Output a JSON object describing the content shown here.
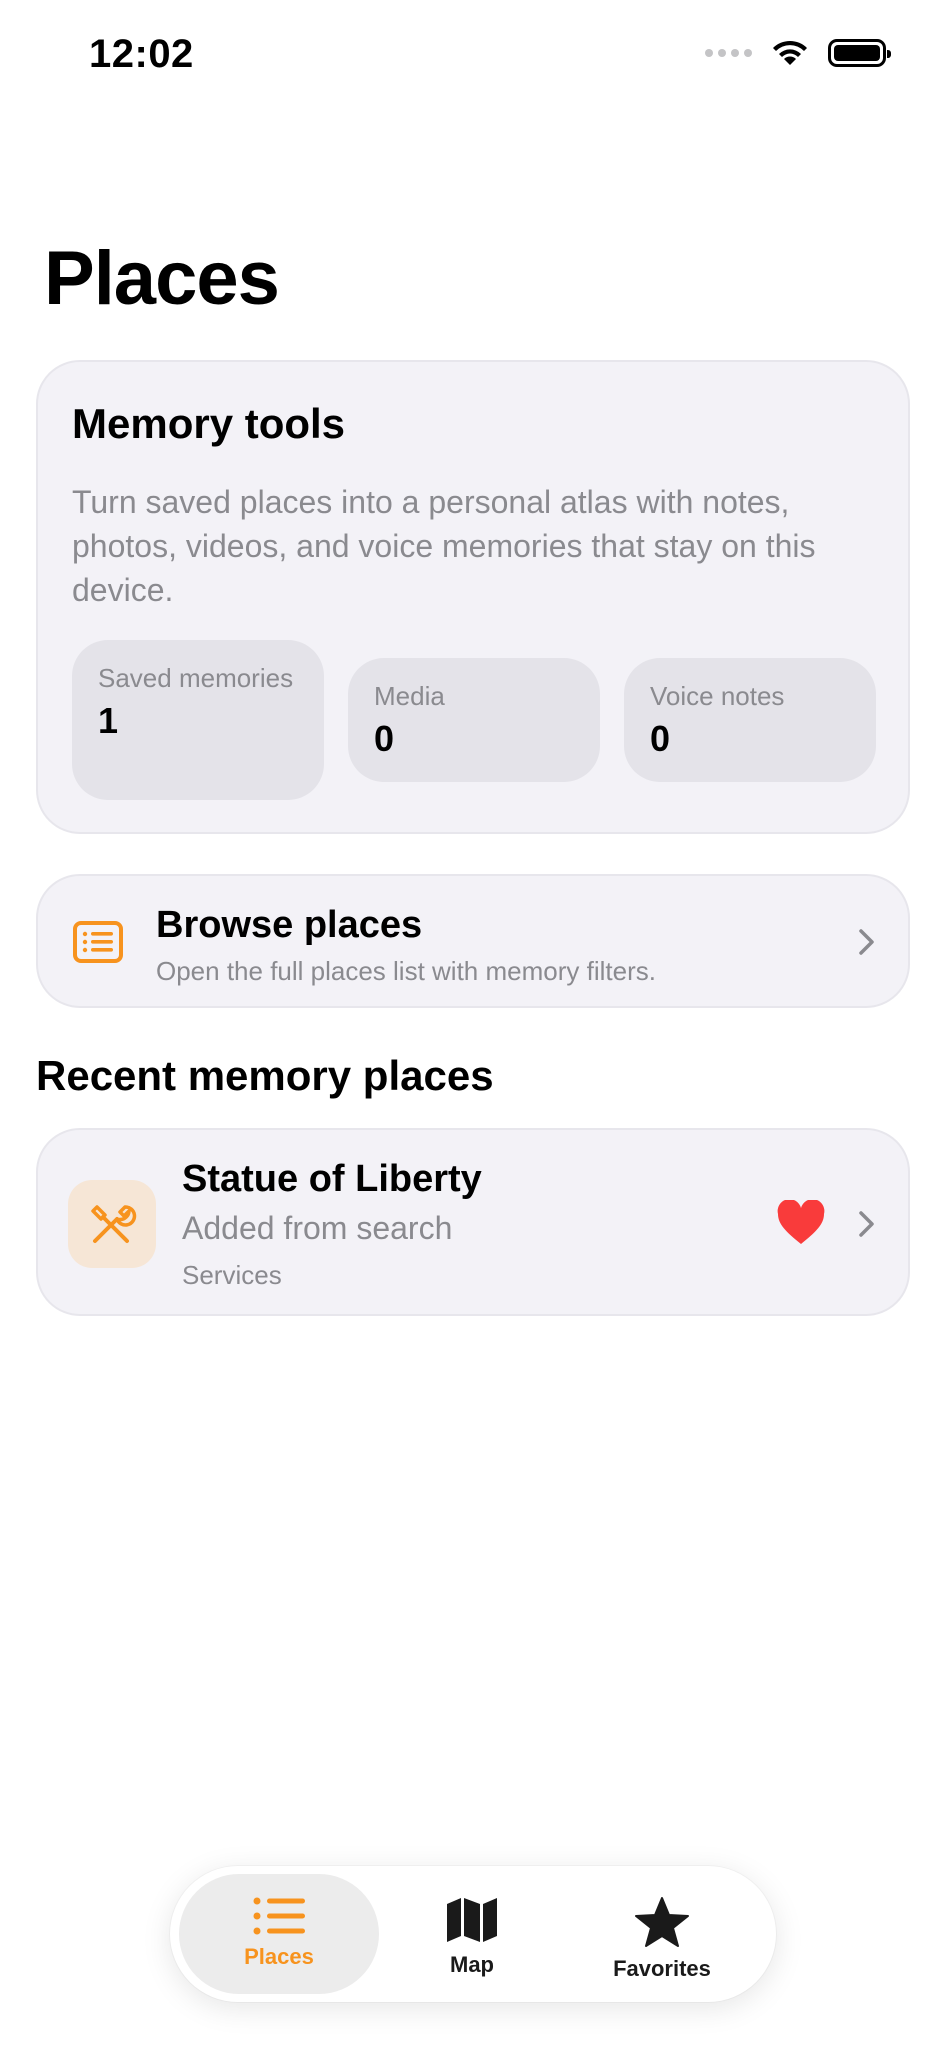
{
  "status_bar": {
    "time": "12:02"
  },
  "header": {
    "title": "Places"
  },
  "memory_tools": {
    "title": "Memory tools",
    "description": "Turn saved places into a personal atlas with notes, photos, videos, and voice memories that stay on this device.",
    "stats": [
      {
        "label": "Saved memories",
        "value": "1"
      },
      {
        "label": "Media",
        "value": "0"
      },
      {
        "label": "Voice notes",
        "value": "0"
      }
    ]
  },
  "browse": {
    "title": "Browse places",
    "subtitle": "Open the full places list with memory filters.",
    "icon": "list-box-icon"
  },
  "recent": {
    "title": "Recent memory places",
    "items": [
      {
        "name": "Statue of Liberty",
        "subtitle": "Added from search",
        "category": "Services",
        "icon": "tools-icon",
        "favorite": true
      }
    ]
  },
  "tab_bar": {
    "tabs": [
      {
        "label": "Places",
        "icon": "list-icon",
        "active": true
      },
      {
        "label": "Map",
        "icon": "map-icon",
        "active": false
      },
      {
        "label": "Favorites",
        "icon": "star-icon",
        "active": false
      }
    ]
  },
  "colors": {
    "accent": "#F7931E",
    "heart": "#F93B3B",
    "card": "#F3F2F7",
    "secondary_text": "#8A8A8F"
  }
}
